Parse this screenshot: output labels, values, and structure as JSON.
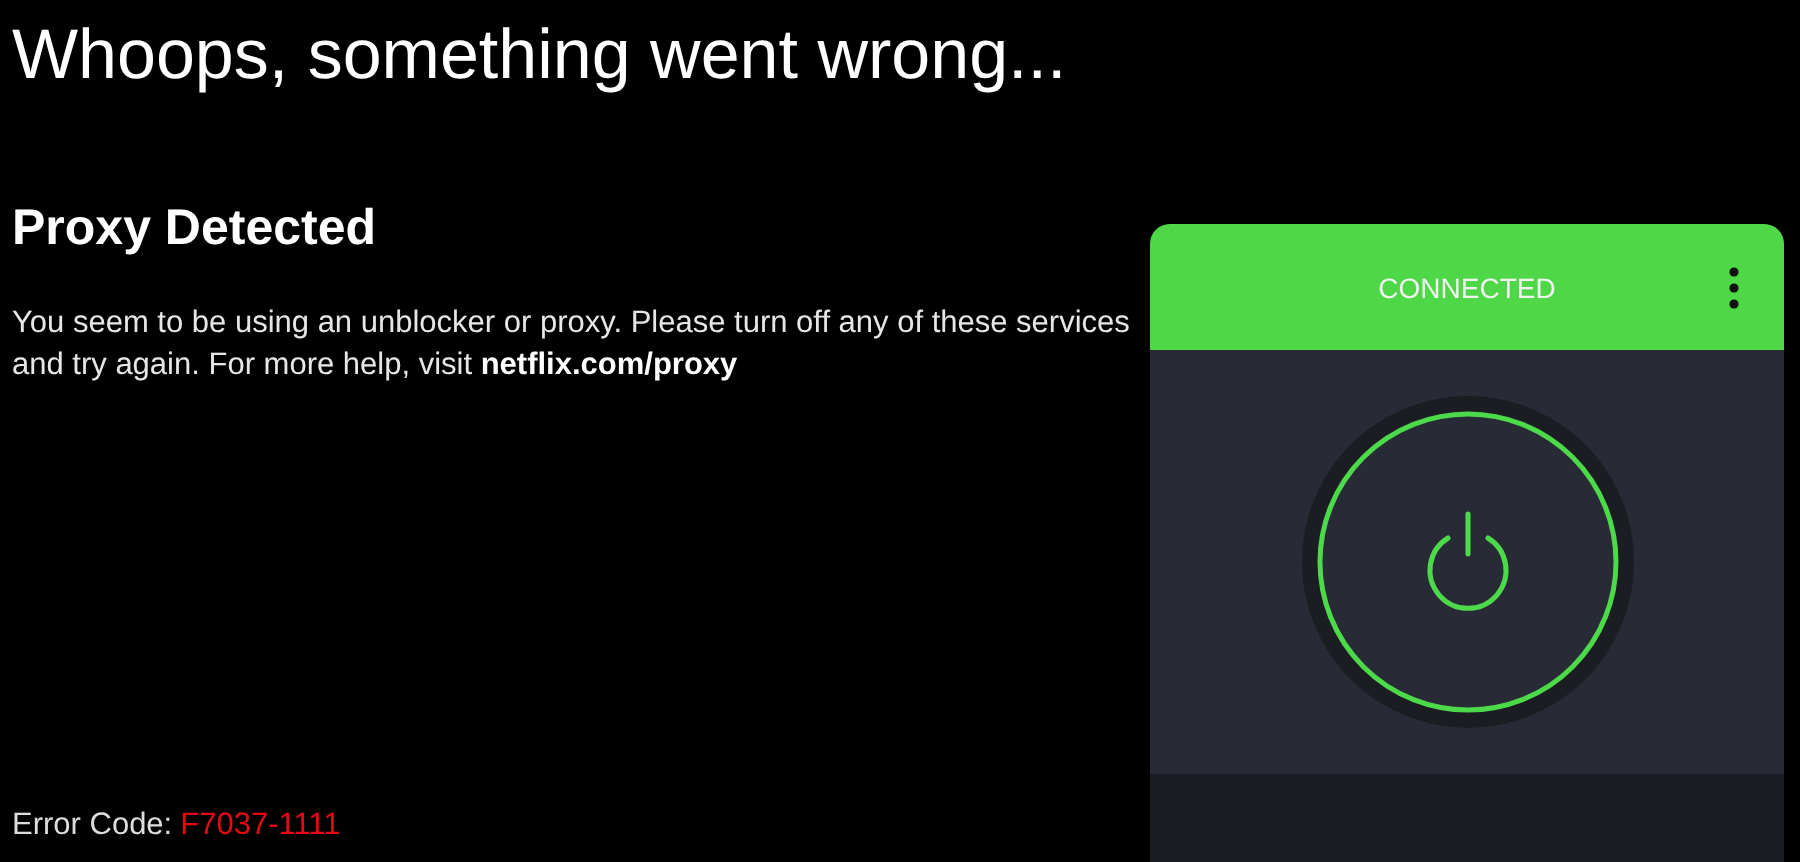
{
  "title": "Whoops, something went wrong...",
  "error": {
    "heading": "Proxy Detected",
    "message": "You seem to be using an unblocker or proxy. Please turn off any of these services and try again. For more help, visit",
    "link": "netflix.com/proxy",
    "code_label": "Error Code:",
    "code": "F7037-1111"
  },
  "vpn": {
    "status": "CONNECTED",
    "connected": true
  }
}
